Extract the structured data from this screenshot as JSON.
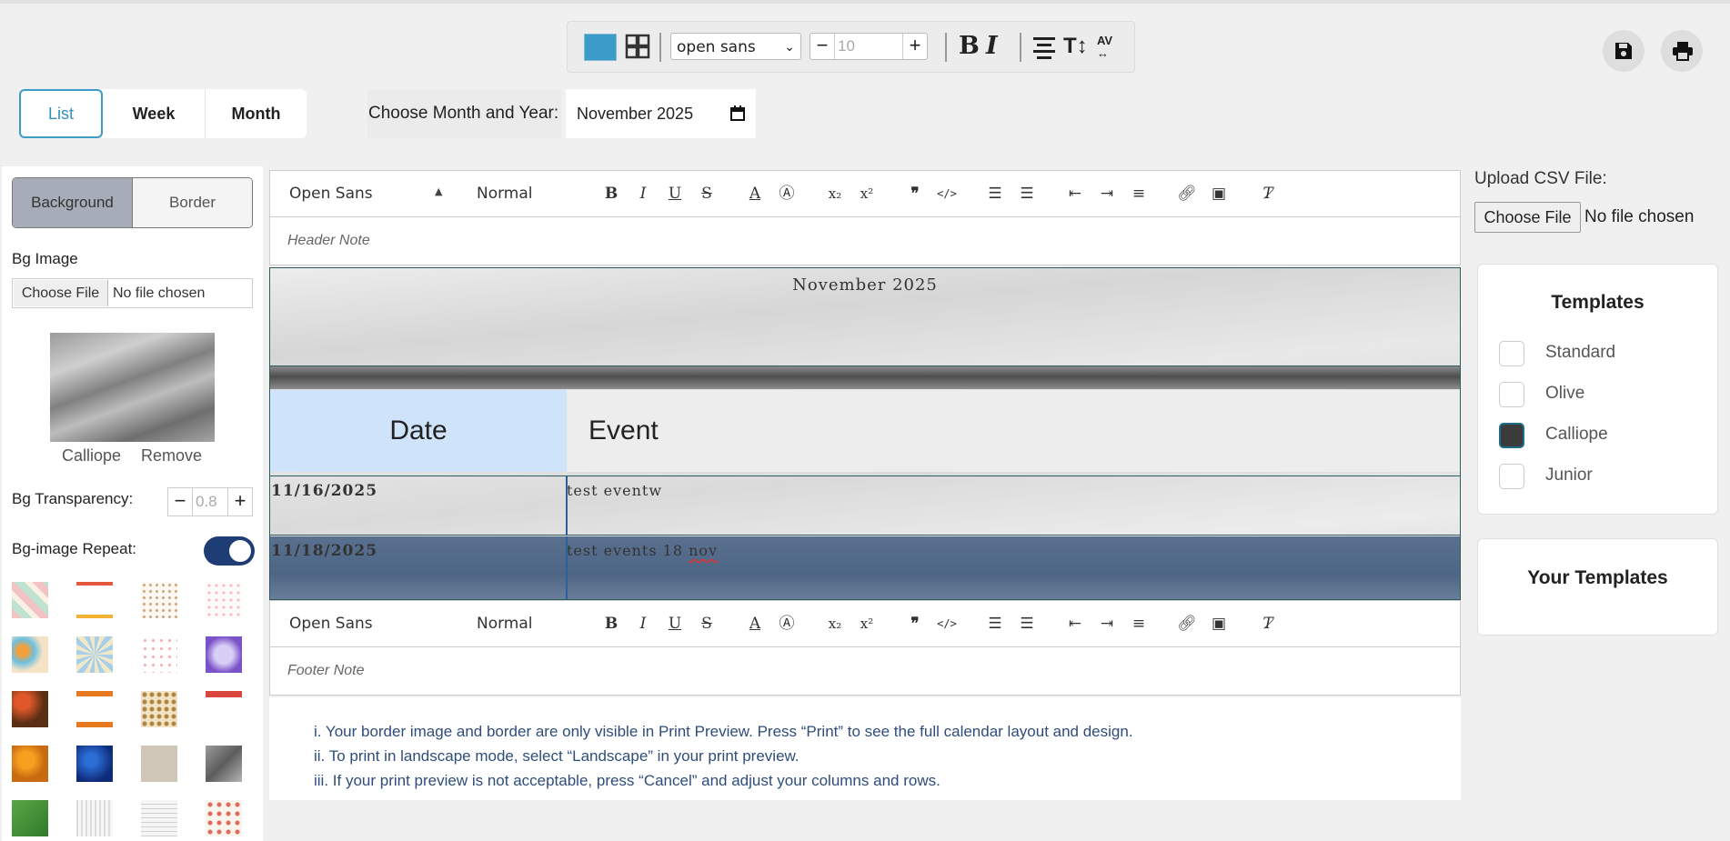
{
  "toolbar": {
    "font": "open sans",
    "font_size_placeholder": "10",
    "accent_color": "#3d9bc7"
  },
  "views": {
    "tabs": [
      "List",
      "Week",
      "Month"
    ],
    "active": "List"
  },
  "month_picker": {
    "label": "Choose Month and Year:",
    "value": "November 2025"
  },
  "left_panel": {
    "segments": [
      "Background",
      "Border"
    ],
    "bg_image_label": "Bg Image",
    "file_button": "Choose File",
    "file_status": "No file chosen",
    "thumb_name": "Calliope",
    "remove_label": "Remove",
    "transparency_label": "Bg Transparency:",
    "transparency_placeholder": "0.8",
    "repeat_label": "Bg-image Repeat:",
    "repeat_on": true
  },
  "editor": {
    "header_font": "Open Sans",
    "header_size": "Normal",
    "header_note": "Header Note",
    "footer_font": "Open Sans",
    "footer_size": "Normal",
    "footer_note": "Footer Note"
  },
  "calendar": {
    "title": "November 2025",
    "headers": {
      "date": "Date",
      "event": "Event"
    },
    "rows": [
      {
        "date": "11/16/2025",
        "event": "test eventw"
      },
      {
        "date": "11/18/2025",
        "event_prefix": "test events 18 ",
        "event_misspelled": "nov"
      }
    ]
  },
  "notes": [
    "i. Your border image and border are only visible in Print Preview. Press “Print” to see the full calendar layout and design.",
    "ii. To print in landscape mode, select “Landscape” in your print preview.",
    "iii. If your print preview is not acceptable, press “Cancel” and adjust your columns and rows."
  ],
  "right_panel": {
    "csv_label": "Upload CSV File:",
    "file_button": "Choose File",
    "file_status": "No file chosen",
    "templates_title": "Templates",
    "templates": [
      {
        "name": "Standard",
        "checked": false
      },
      {
        "name": "Olive",
        "checked": false
      },
      {
        "name": "Calliope",
        "checked": true
      },
      {
        "name": "Junior",
        "checked": false
      }
    ],
    "your_templates_title": "Your Templates"
  },
  "icons": {
    "top": [
      "color-swatch-icon",
      "grid-icon",
      "bold-icon",
      "italic-icon",
      "align-center-icon",
      "text-size-icon",
      "letter-spacing-icon",
      "save-icon",
      "print-icon"
    ],
    "quill": [
      "bold",
      "italic",
      "underline",
      "strike",
      "font-color",
      "background-color",
      "subscript",
      "superscript",
      "blockquote",
      "code",
      "ordered-list",
      "bullet-list",
      "outdent",
      "indent",
      "align",
      "link",
      "image",
      "clear-format"
    ]
  }
}
